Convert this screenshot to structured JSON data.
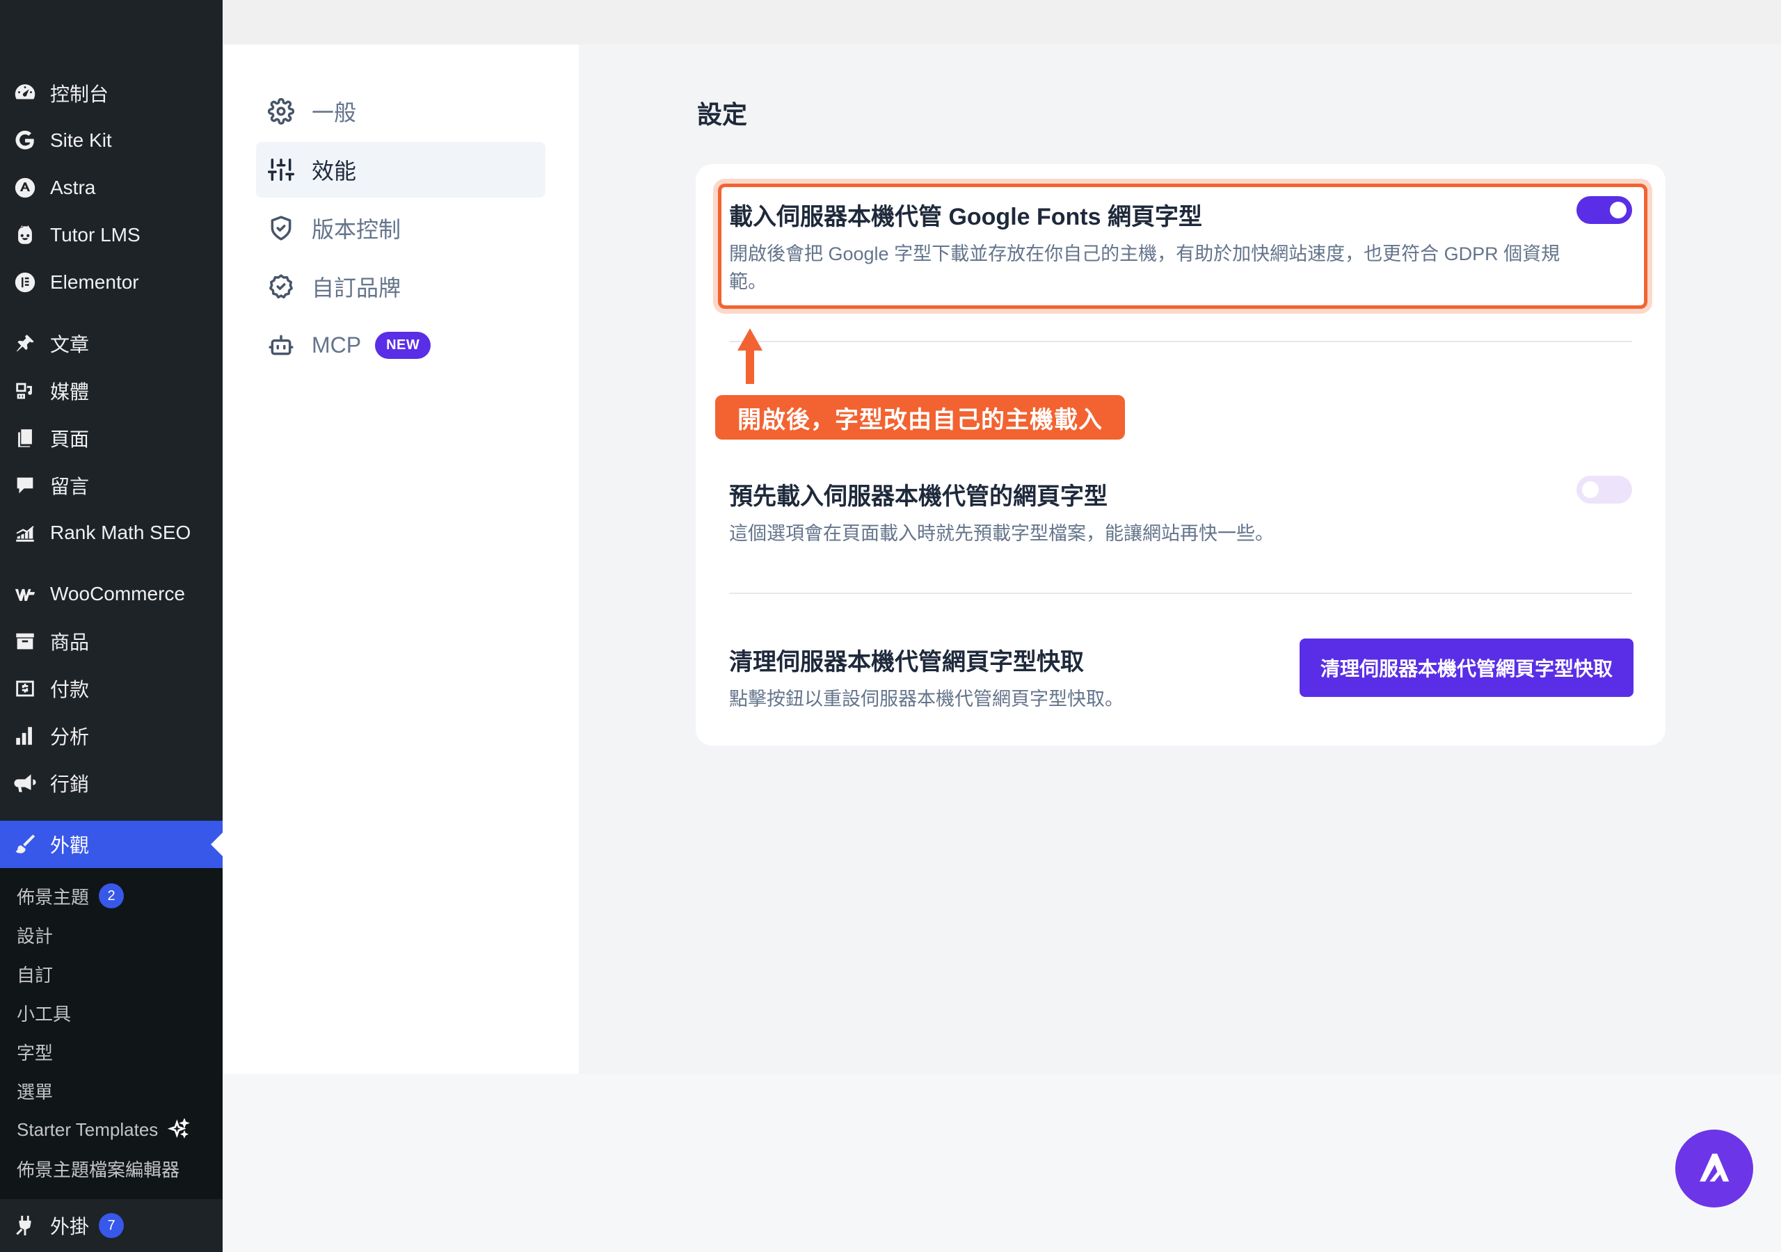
{
  "sidebar": {
    "items": [
      {
        "label": "控制台",
        "icon": "dashboard-icon"
      },
      {
        "label": "Site Kit",
        "icon": "google-icon"
      },
      {
        "label": "Astra",
        "icon": "astra-icon"
      },
      {
        "label": "Tutor LMS",
        "icon": "tutor-icon"
      },
      {
        "label": "Elementor",
        "icon": "elementor-icon"
      },
      {
        "label": "文章",
        "icon": "pin-icon"
      },
      {
        "label": "媒體",
        "icon": "media-icon"
      },
      {
        "label": "頁面",
        "icon": "pages-icon"
      },
      {
        "label": "留言",
        "icon": "comments-icon"
      },
      {
        "label": "Rank Math SEO",
        "icon": "rankmath-icon"
      },
      {
        "label": "WooCommerce",
        "icon": "woo-icon"
      },
      {
        "label": "商品",
        "icon": "archive-icon"
      },
      {
        "label": "付款",
        "icon": "payment-icon"
      },
      {
        "label": "分析",
        "icon": "chart-icon"
      },
      {
        "label": "行銷",
        "icon": "megaphone-icon"
      },
      {
        "label": "外觀",
        "icon": "brush-icon"
      }
    ],
    "appearance_submenu": [
      {
        "label": "佈景主題",
        "count": "2"
      },
      {
        "label": "設計"
      },
      {
        "label": "自訂"
      },
      {
        "label": "小工具"
      },
      {
        "label": "字型"
      },
      {
        "label": "選單"
      },
      {
        "label": "Starter Templates"
      },
      {
        "label": "佈景主題檔案編輯器"
      }
    ],
    "plugins": {
      "label": "外掛",
      "count": "7"
    }
  },
  "settings_nav": {
    "items": [
      {
        "label": "一般",
        "icon": "gear-icon"
      },
      {
        "label": "效能",
        "icon": "sliders-icon"
      },
      {
        "label": "版本控制",
        "icon": "shield-icon"
      },
      {
        "label": "自訂品牌",
        "icon": "verified-badge-icon"
      },
      {
        "label": "MCP",
        "icon": "robot-icon",
        "badge": "NEW"
      }
    ],
    "active": "效能"
  },
  "main": {
    "title": "設定",
    "settings": [
      {
        "title": "載入伺服器本機代管 Google Fonts 網頁字型",
        "description": "開啟後會把 Google 字型下載並存放在你自己的主機，有助於加快網站速度，也更符合 GDPR 個資規範。",
        "enabled": true
      },
      {
        "title": "預先載入伺服器本機代管的網頁字型",
        "description": "這個選項會在頁面載入時就先預載字型檔案，能讓網站再快一些。",
        "enabled": false
      },
      {
        "title": "清理伺服器本機代管網頁字型快取",
        "description": "點擊按鈕以重設伺服器本機代管網頁字型快取。",
        "button_label": "清理伺服器本機代管網頁字型快取"
      }
    ],
    "annotation": "開啟後，字型改由自己的主機載入"
  },
  "colors": {
    "accent": "#5a2ee6",
    "highlight": "#f26331",
    "wp_sidebar": "#1d2327",
    "wp_active": "#3858e9"
  }
}
